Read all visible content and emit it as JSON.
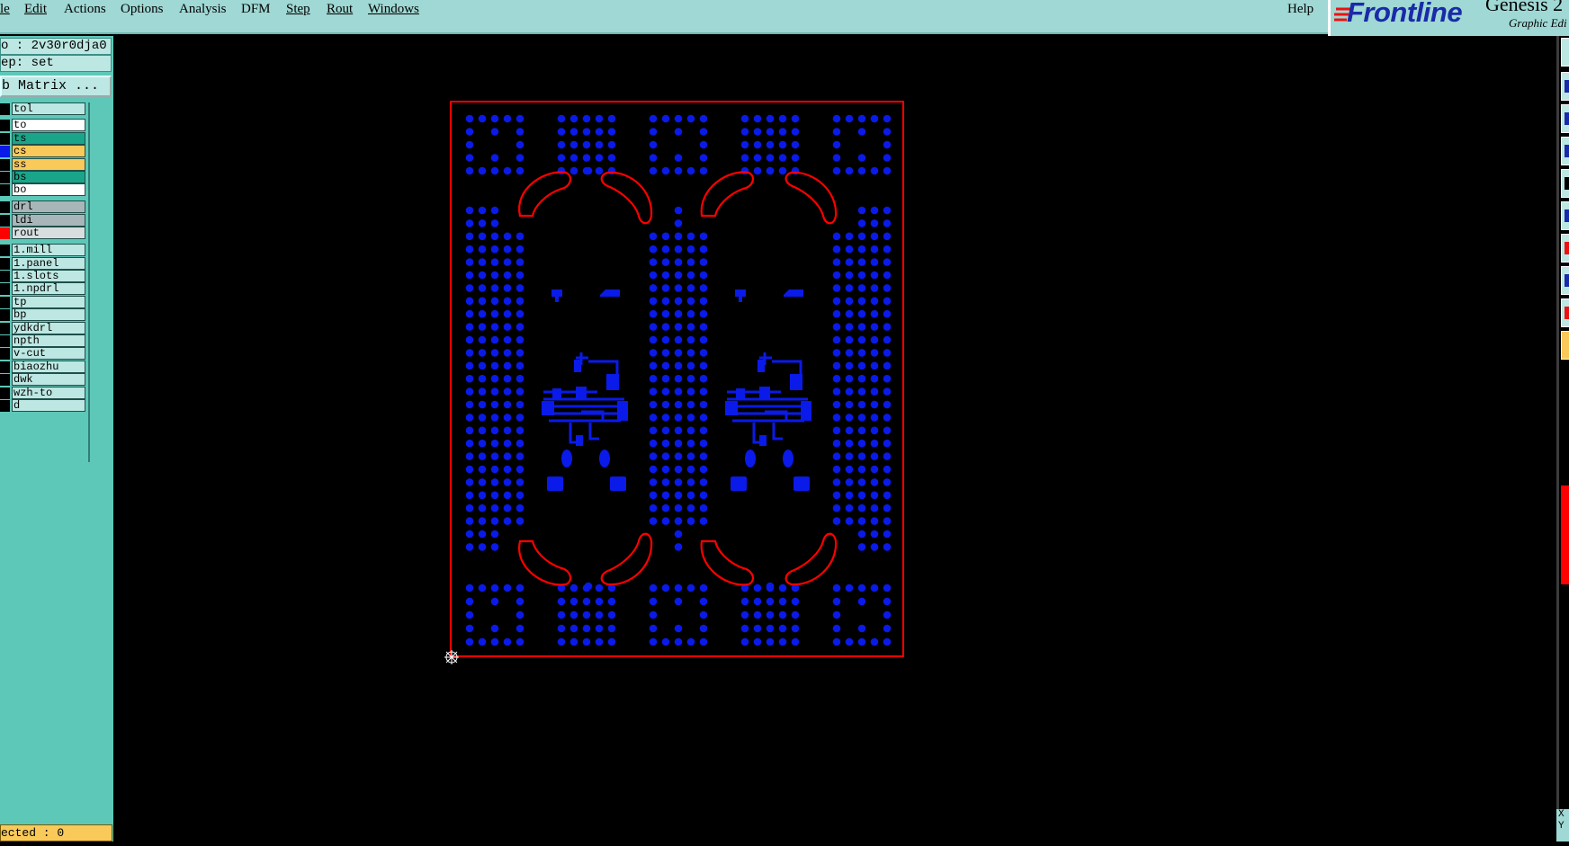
{
  "menubar": {
    "items": [
      "le",
      "Edit",
      "Actions",
      "Options",
      "Analysis",
      "DFM",
      "Step",
      "Rout",
      "Windows"
    ],
    "help": "Help"
  },
  "brand": {
    "logo": "Frontline",
    "title": "Genesis 2",
    "subtitle": "Graphic Edi"
  },
  "job": {
    "job_line": "o : 2v30r0dja0",
    "step_line": "ep: set",
    "matrix_button": "b Matrix ..."
  },
  "layers": [
    {
      "name": "tol",
      "bg": "#bde7e2",
      "swatch": "#000000"
    },
    {
      "name": "to",
      "bg": "#ffffff",
      "swatch": "#000000"
    },
    {
      "name": "ts",
      "bg": "#1aa58a",
      "swatch": "#000000"
    },
    {
      "name": "cs",
      "bg": "#f9c95a",
      "swatch": "#0a1ae8"
    },
    {
      "name": "ss",
      "bg": "#f9c95a",
      "swatch": "#000000"
    },
    {
      "name": "bs",
      "bg": "#1aa58a",
      "swatch": "#000000"
    },
    {
      "name": "bo",
      "bg": "#ffffff",
      "swatch": "#000000"
    },
    {
      "name": "drl",
      "bg": "#a9b6b9",
      "swatch": "#000000"
    },
    {
      "name": "ldi",
      "bg": "#a9b6b9",
      "swatch": "#000000"
    },
    {
      "name": "rout",
      "bg": "#d8dede",
      "swatch": "#ff0000"
    },
    {
      "name": "1.mill",
      "bg": "#bde7e2",
      "swatch": "#000000"
    },
    {
      "name": "1.panel",
      "bg": "#bde7e2",
      "swatch": "#000000"
    },
    {
      "name": "1.slots",
      "bg": "#bde7e2",
      "swatch": "#000000"
    },
    {
      "name": "1.npdrl",
      "bg": "#bde7e2",
      "swatch": "#000000"
    },
    {
      "name": "tp",
      "bg": "#bde7e2",
      "swatch": "#000000"
    },
    {
      "name": "bp",
      "bg": "#bde7e2",
      "swatch": "#000000"
    },
    {
      "name": "ydkdrl",
      "bg": "#bde7e2",
      "swatch": "#000000"
    },
    {
      "name": "npth",
      "bg": "#bde7e2",
      "swatch": "#000000"
    },
    {
      "name": "v-cut",
      "bg": "#bde7e2",
      "swatch": "#000000"
    },
    {
      "name": "biaozhu",
      "bg": "#bde7e2",
      "swatch": "#000000"
    },
    {
      "name": "dwk",
      "bg": "#bde7e2",
      "swatch": "#000000"
    },
    {
      "name": "wzh-to",
      "bg": "#bde7e2",
      "swatch": "#000000"
    },
    {
      "name": "d",
      "bg": "#bde7e2",
      "swatch": "#000000"
    }
  ],
  "status": {
    "selected": "ected : 0"
  },
  "coords": {
    "x": "X",
    "y": "Y"
  },
  "colors": {
    "pad": "#0a1ae8",
    "rout": "#ff0000",
    "panel": "#5ec8b8"
  }
}
